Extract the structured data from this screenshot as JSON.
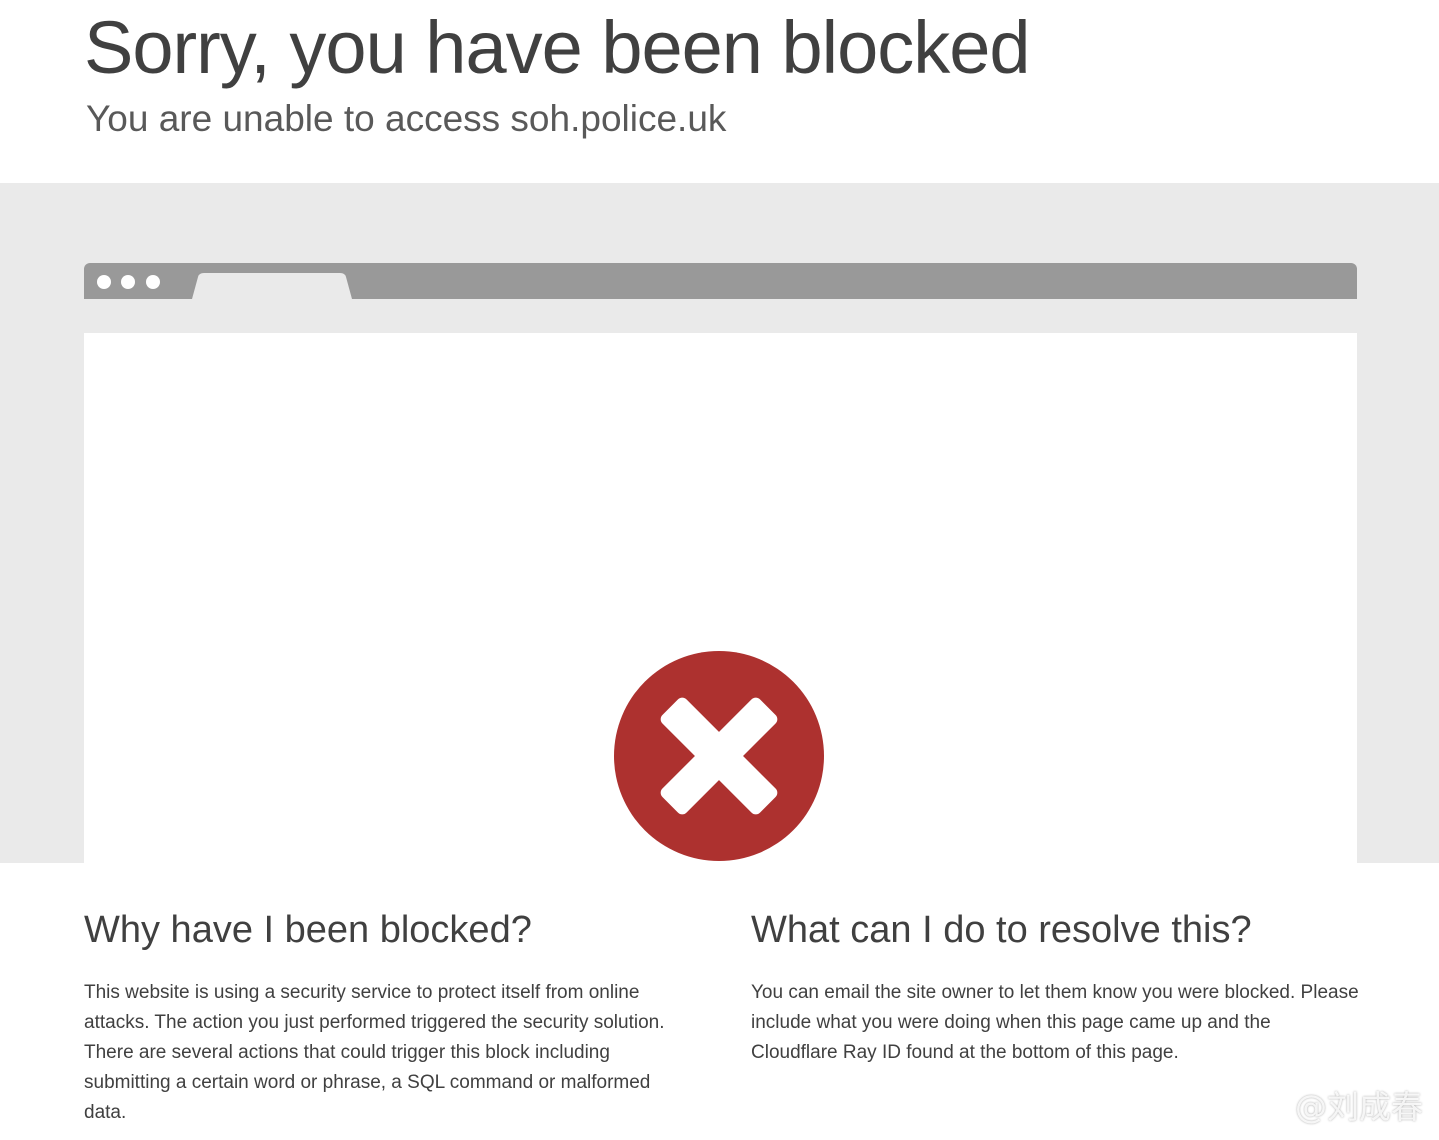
{
  "header": {
    "title": "Sorry, you have been blocked",
    "subtitle": "You are unable to access soh.police.uk"
  },
  "illustration": {
    "icon": "error-x-icon",
    "icon_color": "#ad312f",
    "band_color": "#eaeaea",
    "browser_bar_color": "#999999"
  },
  "why": {
    "heading": "Why have I been blocked?",
    "body": "This website is using a security service to protect itself from online attacks. The action you just performed triggered the security solution. There are several actions that could trigger this block including submitting a certain word or phrase, a SQL command or malformed data."
  },
  "resolve": {
    "heading": "What can I do to resolve this?",
    "body": "You can email the site owner to let them know you were blocked. Please include what you were doing when this page came up and the Cloudflare Ray ID found at the bottom of this page."
  },
  "watermark": {
    "text": "@刘成春"
  }
}
